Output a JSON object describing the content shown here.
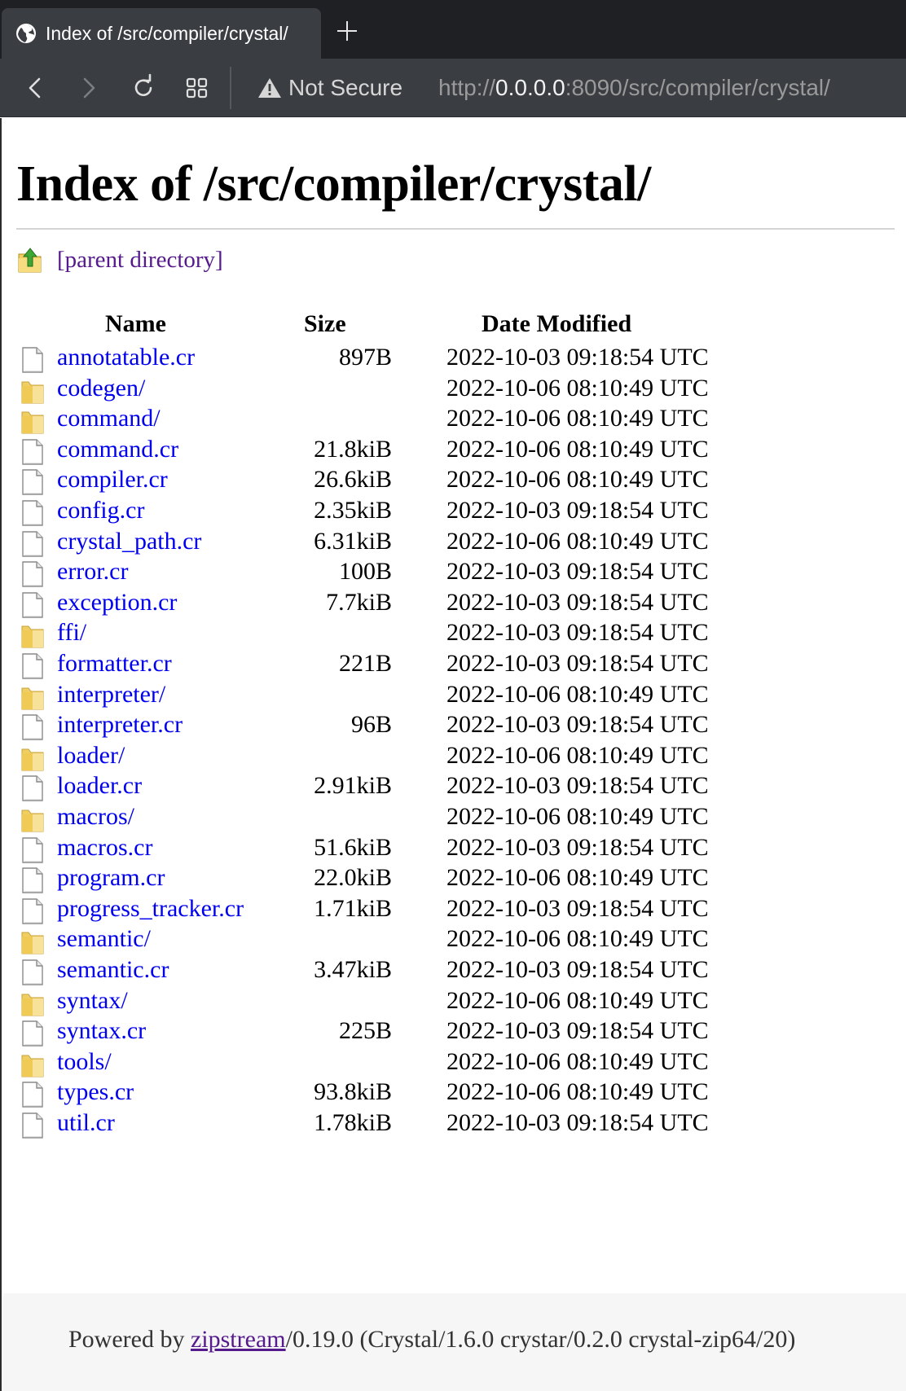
{
  "browser": {
    "tab_title": "Index of /src/compiler/crystal/",
    "security_label": "Not Secure",
    "url_scheme": "http://",
    "url_host": "0.0.0.0",
    "url_rest": ":8090/src/compiler/crystal/"
  },
  "page": {
    "heading": "Index of /src/compiler/crystal/",
    "parent_link": "[parent directory]",
    "columns": {
      "name": "Name",
      "size": "Size",
      "date": "Date Modified"
    }
  },
  "files": [
    {
      "name": "annotatable.cr",
      "type": "file",
      "size": "897B",
      "date": "2022-10-03 09:18:54 UTC"
    },
    {
      "name": "codegen/",
      "type": "folder",
      "size": "",
      "date": "2022-10-06 08:10:49 UTC"
    },
    {
      "name": "command/",
      "type": "folder",
      "size": "",
      "date": "2022-10-06 08:10:49 UTC"
    },
    {
      "name": "command.cr",
      "type": "file",
      "size": "21.8kiB",
      "date": "2022-10-06 08:10:49 UTC"
    },
    {
      "name": "compiler.cr",
      "type": "file",
      "size": "26.6kiB",
      "date": "2022-10-06 08:10:49 UTC"
    },
    {
      "name": "config.cr",
      "type": "file",
      "size": "2.35kiB",
      "date": "2022-10-03 09:18:54 UTC"
    },
    {
      "name": "crystal_path.cr",
      "type": "file",
      "size": "6.31kiB",
      "date": "2022-10-06 08:10:49 UTC"
    },
    {
      "name": "error.cr",
      "type": "file",
      "size": "100B",
      "date": "2022-10-03 09:18:54 UTC"
    },
    {
      "name": "exception.cr",
      "type": "file",
      "size": "7.7kiB",
      "date": "2022-10-03 09:18:54 UTC"
    },
    {
      "name": "ffi/",
      "type": "folder",
      "size": "",
      "date": "2022-10-03 09:18:54 UTC"
    },
    {
      "name": "formatter.cr",
      "type": "file",
      "size": "221B",
      "date": "2022-10-03 09:18:54 UTC"
    },
    {
      "name": "interpreter/",
      "type": "folder",
      "size": "",
      "date": "2022-10-06 08:10:49 UTC"
    },
    {
      "name": "interpreter.cr",
      "type": "file",
      "size": "96B",
      "date": "2022-10-03 09:18:54 UTC"
    },
    {
      "name": "loader/",
      "type": "folder",
      "size": "",
      "date": "2022-10-06 08:10:49 UTC"
    },
    {
      "name": "loader.cr",
      "type": "file",
      "size": "2.91kiB",
      "date": "2022-10-03 09:18:54 UTC"
    },
    {
      "name": "macros/",
      "type": "folder",
      "size": "",
      "date": "2022-10-06 08:10:49 UTC"
    },
    {
      "name": "macros.cr",
      "type": "file",
      "size": "51.6kiB",
      "date": "2022-10-03 09:18:54 UTC"
    },
    {
      "name": "program.cr",
      "type": "file",
      "size": "22.0kiB",
      "date": "2022-10-06 08:10:49 UTC"
    },
    {
      "name": "progress_tracker.cr",
      "type": "file",
      "size": "1.71kiB",
      "date": "2022-10-03 09:18:54 UTC"
    },
    {
      "name": "semantic/",
      "type": "folder",
      "size": "",
      "date": "2022-10-06 08:10:49 UTC"
    },
    {
      "name": "semantic.cr",
      "type": "file",
      "size": "3.47kiB",
      "date": "2022-10-03 09:18:54 UTC"
    },
    {
      "name": "syntax/",
      "type": "folder",
      "size": "",
      "date": "2022-10-06 08:10:49 UTC"
    },
    {
      "name": "syntax.cr",
      "type": "file",
      "size": "225B",
      "date": "2022-10-03 09:18:54 UTC"
    },
    {
      "name": "tools/",
      "type": "folder",
      "size": "",
      "date": "2022-10-06 08:10:49 UTC"
    },
    {
      "name": "types.cr",
      "type": "file",
      "size": "93.8kiB",
      "date": "2022-10-06 08:10:49 UTC"
    },
    {
      "name": "util.cr",
      "type": "file",
      "size": "1.78kiB",
      "date": "2022-10-03 09:18:54 UTC"
    }
  ],
  "footer": {
    "prefix": "Powered by ",
    "link": "zipstream",
    "suffix": "/0.19.0 (Crystal/1.6.0 crystar/0.2.0 crystal-zip64/20)"
  },
  "icons": {
    "tab": "globe-icon",
    "new_tab": "plus-icon",
    "back": "chevron-left-icon",
    "forward": "chevron-right-icon",
    "reload": "reload-icon",
    "tabs_overview": "grid-icon",
    "security": "warning-icon",
    "parent": "folder-up-icon",
    "file": "file-icon",
    "folder": "folder-icon"
  },
  "colors": {
    "link": "#0000ee",
    "visited_link": "#551a8b",
    "chrome_dark": "#1f2023",
    "chrome_toolbar": "#3a3d41"
  }
}
